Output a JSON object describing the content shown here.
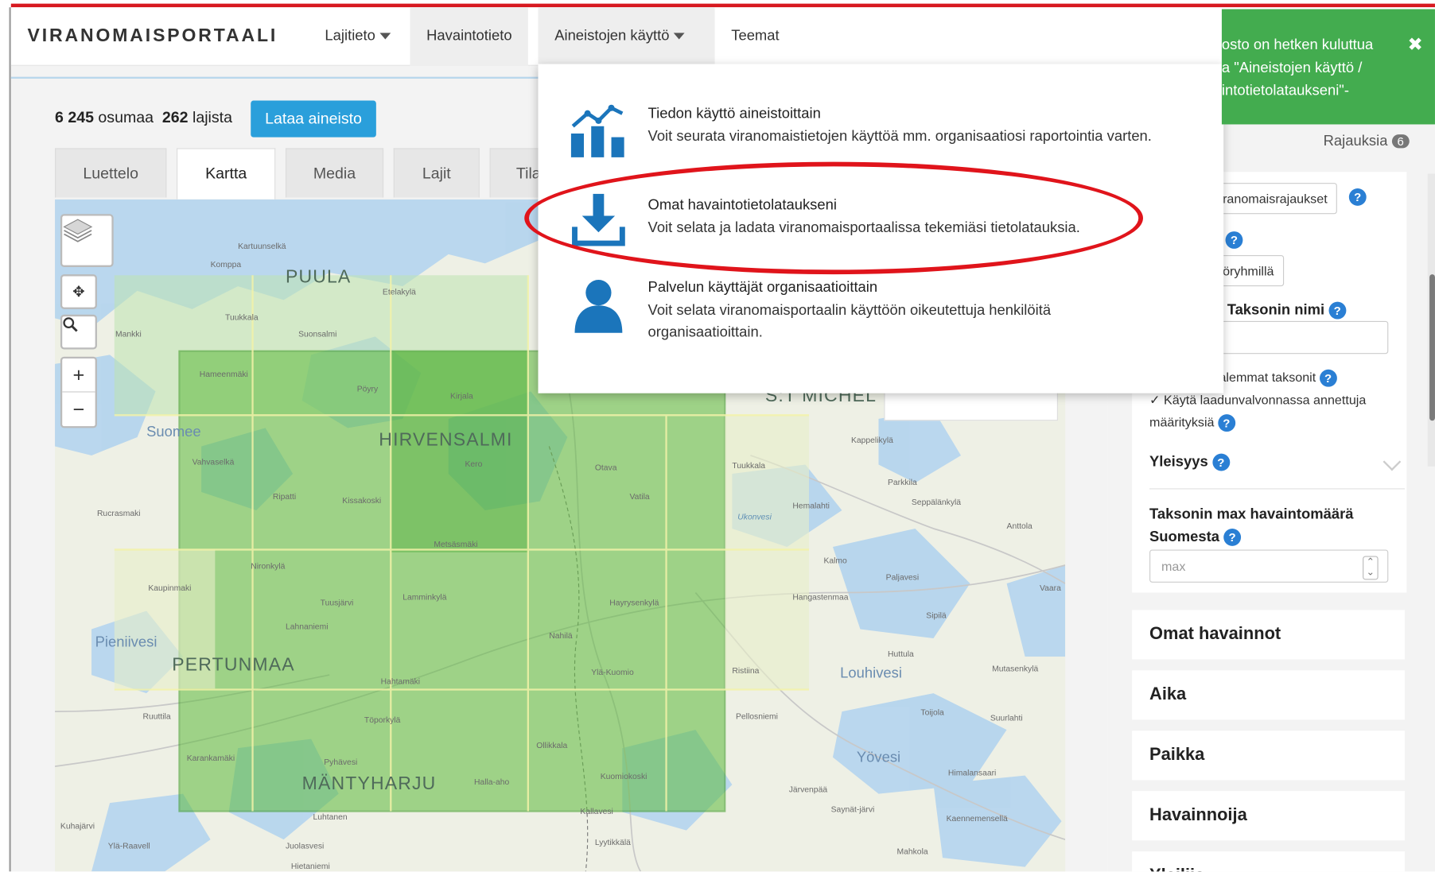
{
  "nav": {
    "brand": "VIRANOMAISPORTAALI",
    "items": [
      {
        "label": "Lajitieto",
        "dropdown": true
      },
      {
        "label": "Havaintotieto",
        "dropdown": false
      },
      {
        "label": "Aineistojen käyttö",
        "dropdown": true
      },
      {
        "label": "Teemat",
        "dropdown": false
      }
    ]
  },
  "results": {
    "observations_count": "6 245",
    "observations_label": "osumaa",
    "species_count": "262",
    "species_label": "lajista",
    "download_button": "Lataa aineisto"
  },
  "tabs": [
    "Luettelo",
    "Kartta",
    "Media",
    "Lajit",
    "Tila"
  ],
  "active_tab": "Kartta",
  "dropdown_menu": {
    "items": [
      {
        "icon": "chart-icon",
        "title": "Tiedon käyttö aineistoittain",
        "desc": "Voit seurata viranomaistietojen käyttöä mm. organisaatiosi raportointia varten."
      },
      {
        "icon": "download-icon",
        "title": "Omat havaintotietolataukseni",
        "desc": "Voit selata ja ladata viranomaisportaalissa tekemiäsi tietolatauksia.",
        "highlighted": true
      },
      {
        "icon": "person-icon",
        "title": "Palvelun käyttäjät organisaatioittain",
        "desc_line1": "Voit selata viranomaisportaalin käyttöön oikeutettuja henkilöitä",
        "desc_line2": "organisaatioittain."
      }
    ]
  },
  "toast": {
    "line1": "osto on hetken kuluttua",
    "line2": "a \"Aineistojen käyttö /",
    "line3": "intotietolataukseni\"-",
    "close": "✖"
  },
  "map": {
    "controls": {
      "zoom_in": "+",
      "zoom_out": "−"
    },
    "labels_big": [
      "PUULA",
      "HIRVENSALMI",
      "PERTUNMAA",
      "MÄNTYHARJU",
      "S:T MICHEL"
    ],
    "labels_lake_big": [
      "Suomee",
      "Louhivesi",
      "Yövesi",
      "Pieniivesi"
    ],
    "labels_small": [
      "Kartuunselkä",
      "Komppa",
      "Etelakylä",
      "Tuukkala",
      "Suonsalmi",
      "Mankki",
      "Hameenmäki",
      "Pöyry",
      "Kirjala",
      "Vahvaselkä",
      "Kero",
      "Ripatti",
      "Kissakoski",
      "Otava",
      "Vatila",
      "Rucrasmaki",
      "Metsäsmäki",
      "Nironkylä",
      "Kaupinmaki",
      "Lamminkylä",
      "Tuusjärvi",
      "Lahnaniemi",
      "Nahilä",
      "Hayrysenkylä",
      "Ylä-Kuomio",
      "Hahtamäki",
      "Ruuttila",
      "Karankamäki",
      "Pyhävesi",
      "Töporkylä",
      "Ollikkala",
      "Halla-aho",
      "Kuomiokoski",
      "Kallavesi",
      "Luhtanen",
      "Kuhajärvi",
      "Ylä-Raavell",
      "Juolasvesi",
      "Hietaniemi",
      "Lyytikkälä",
      "Mahkola",
      "Kaennemensellä",
      "Saynät-järvi",
      "Järvenpää",
      "Himalansaari",
      "Suurlahti",
      "Toijola",
      "Mutasenkylä",
      "Huttula",
      "Sipilä",
      "Pellosniemi",
      "Ristiina",
      "Hangastenmaa",
      "Paljavesi",
      "Vaara",
      "Kalmo",
      "Anttola",
      "Seppälänkylä",
      "Parkkila",
      "Hemalahti",
      "Ukonvesi",
      "Tuukkala",
      "Kappelikylä",
      "Rajauksia"
    ]
  },
  "sidebar": {
    "rajauksia_label": "Rajauksia",
    "rajauksia_count": "6",
    "viranomaisrajaukset_button": "ranomaisrajaukset",
    "ryhmilla_button": "öryhmillä",
    "taxon_name_label": "/ Taksonin nimi",
    "alemmat_label": "alemmat taksonit",
    "laadunvalvonta_line1": "Käytä laadunvalvonnassa annettuja",
    "laadunvalvonta_line2": "määrityksiä",
    "yleisyys_label": "Yleisyys",
    "max_label_line1": "Taksonin max havaintomäärä",
    "max_label_line2": "Suomesta",
    "max_placeholder": "max",
    "sections": [
      "Omat havainnot",
      "Aika",
      "Paikka",
      "Havainnoija",
      "Yleiliis"
    ]
  },
  "colors": {
    "accent_red": "#d71920",
    "button_blue": "#2a9fdb",
    "toast_green": "#43ac4f",
    "grid_green": "#5dbb3b",
    "highlight_ellipse": "#e0141b"
  }
}
